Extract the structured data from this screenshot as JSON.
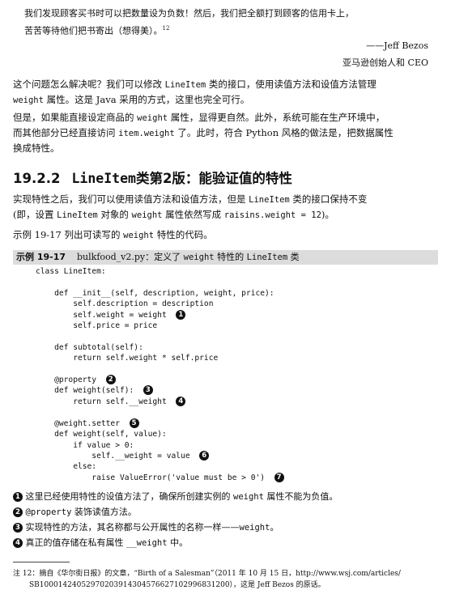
{
  "quote": {
    "line1": "我们发现顾客买书时可以把数量设为负数！然后，我们把全额打到顾客的信用卡上，",
    "line2": "苦苦等待他们把书寄出（想得美）。",
    "ref": "12",
    "author": "——Jeff Bezos",
    "author_title": "亚马逊创始人和 CEO"
  },
  "para1": {
    "a": "这个问题怎么解决呢？我们可以修改 ",
    "b": "LineItem",
    "c": " 类的接口，使用读值方法和设值方法管理",
    "d": "weight",
    "e": " 属性。这是 Java 采用的方式，这里也完全可行。"
  },
  "para2": {
    "a": "但是，如果能直接设定商品的 ",
    "b": "weight",
    "c": " 属性，显得更自然。此外，系统可能在生产环境中，",
    "d": "而其他部分已经直接访问 ",
    "e": "item.weight",
    "f": " 了。此时，符合 Python 风格的做法是，把数据属性",
    "g": "换成特性。"
  },
  "section": {
    "number": "19.2.2",
    "mono": "LineItem",
    "title": "类第2版：能验证值的特性"
  },
  "para3": {
    "a": "实现特性之后，我们可以使用读值方法和设值方法，但是 ",
    "b": "LineItem",
    "c": " 类的接口保持不变",
    "d": "(即，设置 ",
    "e": "LineItem",
    "f": " 对象的 ",
    "g": "weight",
    "h": " 属性依然写成 ",
    "i": "raisins.weight = 12",
    "j": ")。"
  },
  "para4": {
    "a": "示例 19-17 列出可读写的 ",
    "b": "weight",
    "c": " 特性的代码。"
  },
  "example": {
    "label": "示例 19-17",
    "file": "bulkfood_v2.py：定义了 ",
    "mono": "weight",
    "mid": " 特性的 ",
    "mono2": "LineItem",
    "end": " 类"
  },
  "code": {
    "l1": "class LineItem:",
    "l2": "    def __init__(self, description, weight, price):",
    "l3": "        self.description = description",
    "l4": "        self.weight = weight",
    "l5": "        self.price = price",
    "l6": "    def subtotal(self):",
    "l7": "        return self.weight * self.price",
    "l8": "    @property",
    "l9": "    def weight(self):",
    "l10": "        return self.__weight",
    "l11": "    @weight.setter",
    "l12": "    def weight(self, value):",
    "l13": "        if value > 0:",
    "l14": "            self.__weight = value",
    "l15": "        else:",
    "l16": "            raise ValueError('value must be > 0')"
  },
  "callouts": [
    "1",
    "2",
    "3",
    "4",
    "5",
    "6",
    "7"
  ],
  "notes": {
    "n1a": " 这里已经使用特性的设值方法了，确保所创建实例的 ",
    "n1b": "weight",
    "n1c": " 属性不能为负值。",
    "n2a": " ",
    "n2b": "@property",
    "n2c": " 装饰读值方法。",
    "n3a": " 实现特性的方法，其名称都与公开属性的名称一样——",
    "n3b": "weight",
    "n3c": "。",
    "n4a": " 真正的值存储在私有属性 ",
    "n4b": "__weight",
    "n4c": " 中。"
  },
  "footnote": {
    "line1": "注 12：摘自《华尔街日报》的文章，“Birth of a Salesman”（2011 年 10 月 15 日，http://www.wsj.com/articles/",
    "line2": "SB10001424052970203914304576627102996831200），这是 Jeff Bezos 的原话。"
  }
}
